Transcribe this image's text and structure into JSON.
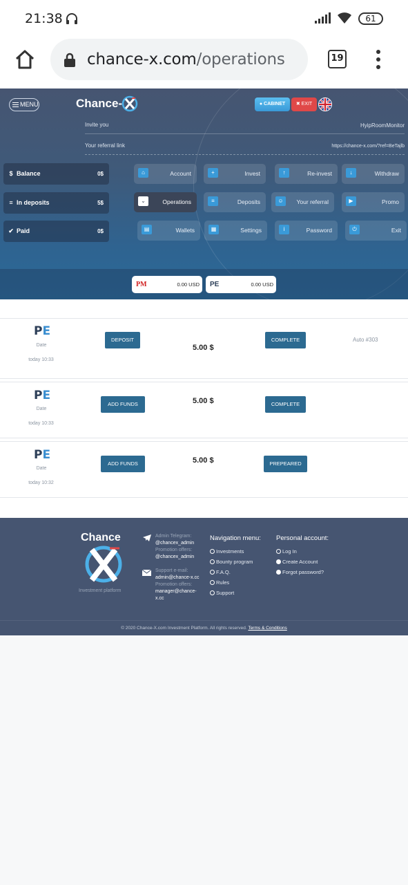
{
  "status_bar": {
    "time": "21:38",
    "battery": "61"
  },
  "browser": {
    "url_domain": "chance-x.com",
    "url_path": "/operations",
    "tab_count": "19"
  },
  "header": {
    "menu_label": "MENU",
    "logo_text": "Chance-",
    "cabinet_label": "CABINET",
    "exit_label": "EXIT",
    "invite_label": "Invite you",
    "invite_value": "HyipRoomMonitor",
    "ref_label": "Your referral link",
    "ref_value": "https://chance-x.com/?ref=BeTajlb"
  },
  "stats": [
    {
      "label": "Balance",
      "value": "0$",
      "icon": "dollar-icon"
    },
    {
      "label": "In deposits",
      "value": "5$",
      "icon": "database-icon"
    },
    {
      "label": "Paid",
      "value": "0$",
      "icon": "check-circle-icon"
    }
  ],
  "nav": {
    "account": "Account",
    "invest": "Invest",
    "reinvest": "Re-invest",
    "withdraw": "Withdraw",
    "operations": "Operations",
    "deposits": "Deposits",
    "referral": "Your referral",
    "promo": "Promo",
    "wallets": "Wallets",
    "settings": "Settings",
    "password": "Password",
    "exit": "Exit"
  },
  "wallets": [
    {
      "label": "PM",
      "amount": "0.00 USD"
    },
    {
      "label": "PE",
      "amount": "0.00 USD"
    }
  ],
  "operations": [
    {
      "system_p": "P",
      "system_e": "E",
      "date_label": "Date",
      "when": "today 10:33",
      "type": "DEPOSIT",
      "amount": "5.00 $",
      "status": "COMPLETE",
      "ref": "Auto #303"
    },
    {
      "system_p": "P",
      "system_e": "E",
      "date_label": "Date",
      "when": "today 10:33",
      "type": "ADD FUNDS",
      "amount": "5.00 $",
      "status": "COMPLETE",
      "ref": ""
    },
    {
      "system_p": "P",
      "system_e": "E",
      "date_label": "Date",
      "when": "today 10:32",
      "type": "ADD FUNDS",
      "amount": "5.00 $",
      "status": "PREPEARED",
      "ref": ""
    }
  ],
  "footer": {
    "brand": "Chance",
    "tagline": "Investment platform",
    "tg_label": "Admin Telegram:",
    "tg_admin": "@chancex_admin",
    "tg_promo_label": "Promotion offers:",
    "tg_promo": "@chancex_admin",
    "mail_label": "Support e-mail:",
    "mail_admin": "admin@chance-x.cc",
    "mail_promo_label": "Promotion offers:",
    "mail_promo": "manager@chance-x.cc",
    "nav_title": "Navigation menu:",
    "nav_items": [
      "Investments",
      "Bounty program",
      "F.A.Q.",
      "Rules",
      "Support"
    ],
    "account_title": "Personal account:",
    "account_items": [
      "Log In",
      "Create Account",
      "Forgot password?"
    ],
    "copyright": "© 2020 Chance-X.com Investment Platform. All rights reserved.",
    "terms": "Terms & Conditions"
  },
  "colors": {
    "hero_top": "#465571",
    "hero_bottom": "#2a6a99",
    "button": "#2c6a91",
    "accent": "#3a9ad8",
    "exit": "#e04848"
  }
}
